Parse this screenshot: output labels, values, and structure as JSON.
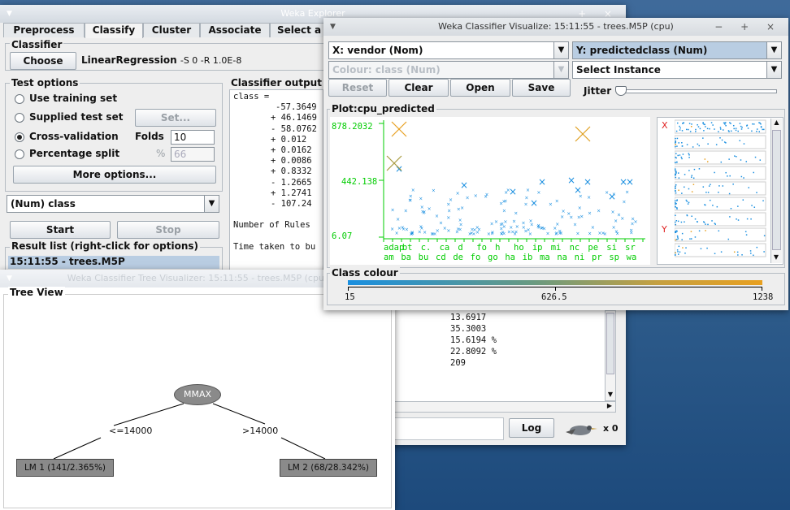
{
  "explorer": {
    "title": "Weka Explorer",
    "tabs": [
      "Preprocess",
      "Classify",
      "Cluster",
      "Associate",
      "Select a"
    ],
    "classifier_label": "Classifier",
    "choose": "Choose",
    "classifier_name": "LinearRegression",
    "classifier_opts": "-S 0 -R 1.0E-8",
    "test_options_label": "Test options",
    "opt_training": "Use training set",
    "opt_supplied": "Supplied test set",
    "set_btn": "Set...",
    "opt_cv": "Cross-validation",
    "folds_label": "Folds",
    "folds_value": "10",
    "opt_split": "Percentage split",
    "pct_symbol": "%",
    "pct_value": "66",
    "more_options": "More options...",
    "class_select": "(Num) class",
    "start": "Start",
    "stop": "Stop",
    "result_label": "Result list (right-click for options)",
    "result_item": "15:11:55 - trees.M5P",
    "output_label": "Classifier output",
    "output_lines": [
      "class =",
      "-57.3649",
      "+ 46.1469",
      "- 58.0762",
      "+ 0.012",
      "+ 0.0162",
      "+ 0.0086",
      "+ 0.8332",
      "- 1.2665",
      "+ 1.2741",
      "- 107.24",
      "",
      "Number of Rules",
      "",
      "Time taken to bu"
    ],
    "stats_lines": [
      "13.6917",
      "35.3003",
      "15.6194 %",
      "22.8092 %",
      "209"
    ],
    "log_btn": "Log",
    "x_count": "x 0"
  },
  "visualize": {
    "title": "Weka Classifier Visualize: 15:11:55 - trees.M5P (cpu)",
    "x_axis": "X: vendor (Nom)",
    "y_axis": "Y: predictedclass (Num)",
    "colour": "Colour: class (Num)",
    "select_instance": "Select Instance",
    "reset": "Reset",
    "clear": "Clear",
    "open": "Open",
    "save": "Save",
    "jitter": "Jitter",
    "plot_label": "Plot:cpu_predicted",
    "y_ticks": [
      "878.2032",
      "442.138",
      "6.07"
    ],
    "x_ticks_top": [
      "adap",
      "bt",
      "c.",
      "ca",
      "d",
      "fo",
      "h",
      "ho",
      "ip",
      "mi",
      "nc",
      "pe",
      "si",
      "sr"
    ],
    "x_ticks_bottom": [
      "am",
      "ba",
      "bu",
      "cd",
      "de",
      "fo",
      "go",
      "ha",
      "ib",
      "ma",
      "na",
      "ni",
      "pr",
      "sp",
      "wa"
    ],
    "xy_x": "X",
    "xy_y": "Y",
    "class_colour_label": "Class colour",
    "colour_ticks": [
      "15",
      "626.5",
      "1238"
    ],
    "colors": {
      "low": "#1a8fe0",
      "high": "#e8a020",
      "axis": "#00cc00"
    }
  },
  "tree": {
    "title": "Weka Classifier Tree Visualizer: 15:11:55 - trees.M5P (cpu)",
    "view_label": "Tree View",
    "root": "MMAX",
    "left_edge": "<=14000",
    "right_edge": ">14000",
    "left_leaf": "LM 1 (141/2.365%)",
    "right_leaf": "LM 2 (68/28.342%)"
  }
}
